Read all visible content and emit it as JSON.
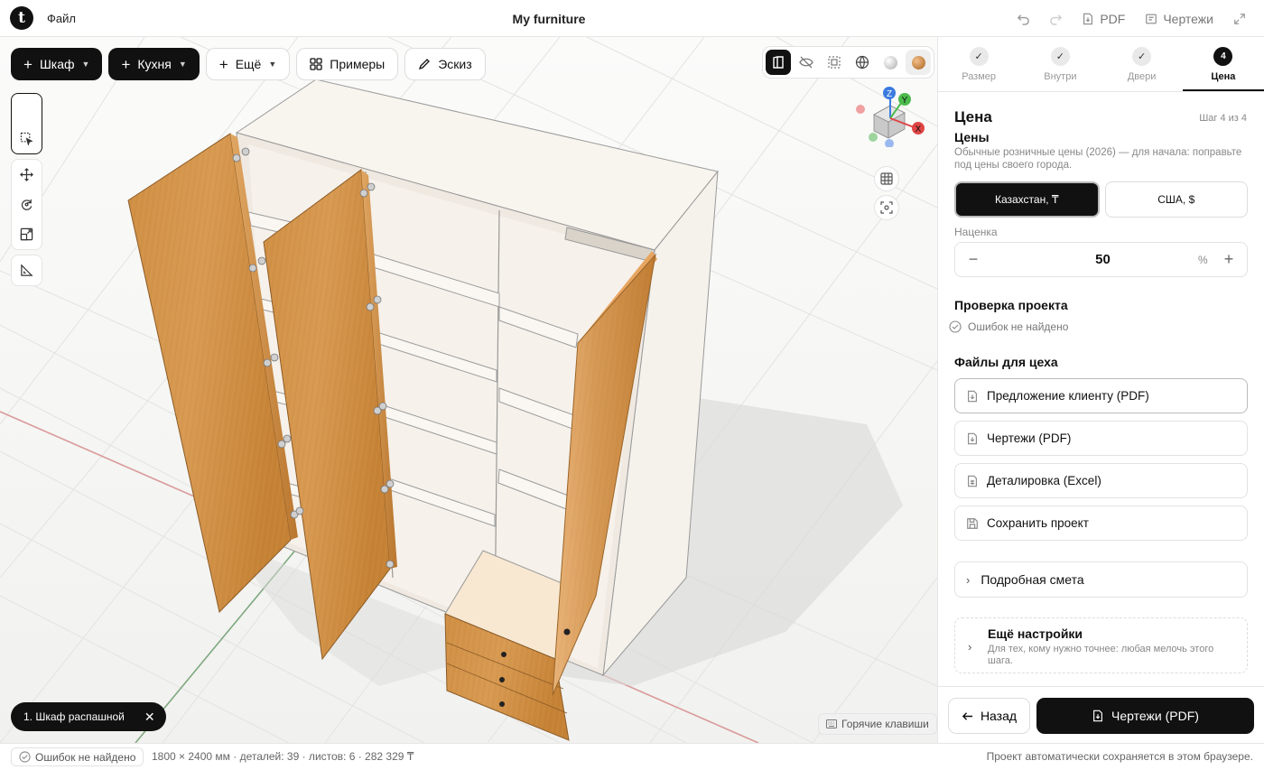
{
  "app": {
    "file_menu": "Файл",
    "title": "My furniture"
  },
  "topbar": {
    "pdf": "PDF",
    "drawings": "Чертежи"
  },
  "toolbar": {
    "wardrobe": "Шкаф",
    "kitchen": "Кухня",
    "more": "Ещё",
    "examples": "Примеры",
    "sketch": "Эскиз"
  },
  "gizmo": {
    "z": "Z",
    "y": "Y",
    "x": "X"
  },
  "viewport": {
    "cabinet_chip": "1. Шкаф распашной",
    "hotkeys": "Горячие клавиши"
  },
  "statusbar": {
    "errors": "Ошибок не найдено",
    "info": "1800 × 2400 мм · деталей: 39 · листов: 6 · 282 329 ₸",
    "autosave": "Проект автоматически сохраняется в этом браузере."
  },
  "steps": [
    {
      "label": "Размер",
      "mark": "✓"
    },
    {
      "label": "Внутри",
      "mark": "✓"
    },
    {
      "label": "Двери",
      "mark": "✓"
    },
    {
      "label": "Цена",
      "mark": "4"
    }
  ],
  "panel": {
    "title": "Цена",
    "step_count": "Шаг 4 из 4",
    "prices_heading": "Цены",
    "prices_desc": "Обычные розничные цены (2026) — для начала: поправьте под цены своего города.",
    "currency_kz": "Казахстан, ₸",
    "currency_us": "США, $",
    "markup_label": "Наценка",
    "markup_value": "50",
    "markup_unit": "%",
    "check_heading": "Проверка проекта",
    "check_result": "Ошибок не найдено",
    "files_heading": "Файлы для цеха",
    "file_offer": "Предложение клиенту (PDF)",
    "file_drawings": "Чертежи (PDF)",
    "file_details": "Деталировка (Excel)",
    "file_save": "Сохранить проект",
    "estimate": "Подробная смета",
    "more_title": "Ещё настройки",
    "more_desc": "Для тех, кому нужно точнее: любая мелочь этого шага.",
    "back": "Назад",
    "next": "Чертежи (PDF)"
  },
  "colors": {
    "accent": "#111111",
    "wood": "#c98a3e",
    "carcass": "#f6f1ea",
    "axis_x": "#e04545",
    "axis_y": "#4cbb4c",
    "axis_z": "#3a7be0"
  }
}
